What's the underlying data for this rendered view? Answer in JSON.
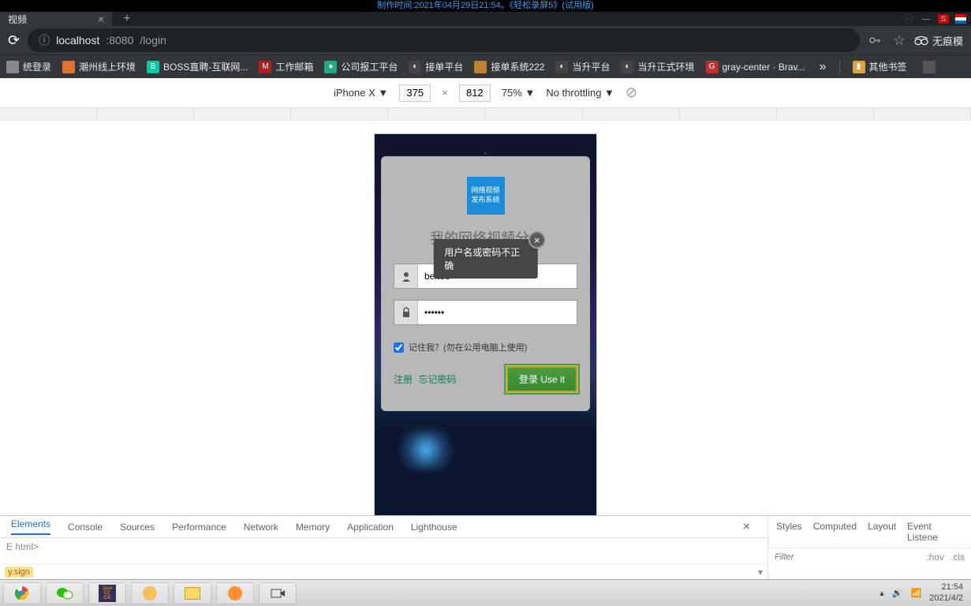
{
  "banner": "制作时间:2021年04月29日21:54。《轻松录屏5》(试用版)",
  "browser": {
    "tab_title": "视频",
    "url_prefix": "localhost",
    "url_port": ":8080",
    "url_path": "/login",
    "incognito_label": "无痕模",
    "bookmarks": [
      {
        "label": "统登录",
        "favbg": "#888",
        "favtxt": ""
      },
      {
        "label": "潮州线上环境",
        "favbg": "#e07030",
        "favtxt": ""
      },
      {
        "label": "BOSS直聘-互联网...",
        "favbg": "#00c9a7",
        "favtxt": "B"
      },
      {
        "label": "工作邮箱",
        "favbg": "#b02020",
        "favtxt": "M"
      },
      {
        "label": "公司报工平台",
        "favbg": "#2a8",
        "favtxt": "●"
      },
      {
        "label": "接单平台",
        "favbg": "#444",
        "favtxt": "◐"
      },
      {
        "label": "接单系统222",
        "favbg": "#c08030",
        "favtxt": ""
      },
      {
        "label": "当升平台",
        "favbg": "#444",
        "favtxt": "◐"
      },
      {
        "label": "当升正式环境",
        "favbg": "#444",
        "favtxt": "◐"
      },
      {
        "label": "gray-center · Brav...",
        "favbg": "#c03030",
        "favtxt": "G"
      }
    ],
    "other_bookmarks": "其他书签"
  },
  "device_bar": {
    "device": "iPhone X ▼",
    "width": "375",
    "height": "812",
    "zoom": "75% ▼",
    "throttle": "No throttling ▼"
  },
  "login": {
    "logo_line1": "网络视频",
    "logo_line2": "发布系统",
    "title": "我的网络视频分...",
    "toast": "用户名或密码不正确",
    "username_value": "beituo",
    "password_display": "••••••",
    "remember_label": "记住我？(勿在公用电脑上使用)",
    "remember_checked": true,
    "register": "注册",
    "forgot": "忘记密码",
    "submit": "登录 Use it"
  },
  "devtools": {
    "tabs": [
      "Elements",
      "Console",
      "Sources",
      "Performance",
      "Network",
      "Memory",
      "Application",
      "Lighthouse"
    ],
    "dom_line": "E html>",
    "crumb": "y.sign",
    "right_tabs": [
      "Styles",
      "Computed",
      "Layout",
      "Event Listene"
    ],
    "filter_placeholder": "Filter",
    "hov": ":hov",
    "cls": ".cls"
  },
  "tray": {
    "time": "21:54",
    "date": "2021/4/2"
  }
}
